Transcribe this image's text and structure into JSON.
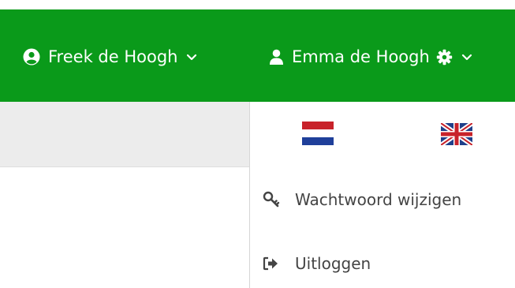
{
  "header": {
    "background_color": "#0a9a1a",
    "users": [
      {
        "name": "Freek de Hoogh",
        "icon": "user-circle-icon",
        "dropdown_icon": "chevron-down-icon"
      },
      {
        "name": "Emma de Hoogh",
        "icon": "user-icon",
        "settings_icon": "gear-icon",
        "dropdown_icon": "chevron-down-icon"
      }
    ]
  },
  "dropdown": {
    "languages": [
      {
        "icon": "flag-nl-icon",
        "code": "nl"
      },
      {
        "icon": "flag-gb-icon",
        "code": "en"
      }
    ],
    "items": [
      {
        "label": "Wachtwoord wijzigen",
        "icon": "key-icon"
      },
      {
        "label": "Uitloggen",
        "icon": "sign-out-icon"
      }
    ]
  }
}
